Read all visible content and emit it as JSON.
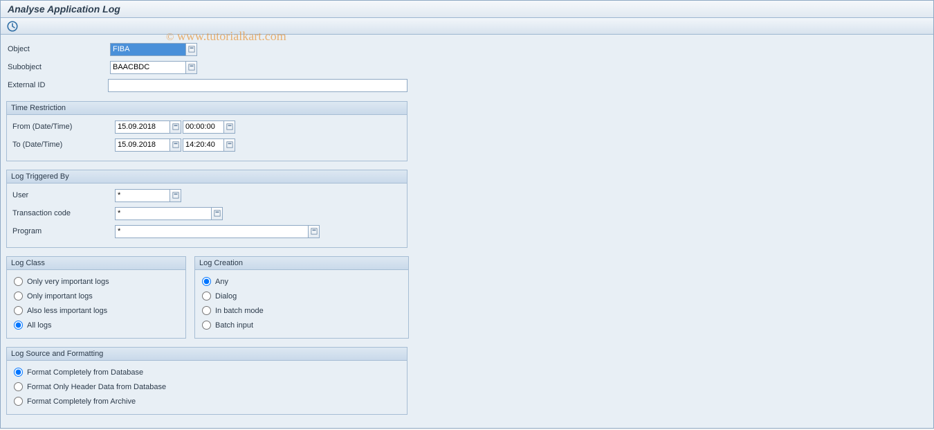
{
  "title": "Analyse Application Log",
  "watermark": "© www.tutorialkart.com",
  "fields": {
    "object_label": "Object",
    "object_value": "FIBA",
    "subobject_label": "Subobject",
    "subobject_value": "BAACBDC",
    "external_id_label": "External ID",
    "external_id_value": ""
  },
  "time_restriction": {
    "title": "Time Restriction",
    "from_label": "From (Date/Time)",
    "from_date": "15.09.2018",
    "from_time": "00:00:00",
    "to_label": "To (Date/Time)",
    "to_date": "15.09.2018",
    "to_time": "14:20:40"
  },
  "log_triggered": {
    "title": "Log Triggered By",
    "user_label": "User",
    "user_value": "*",
    "tcode_label": "Transaction code",
    "tcode_value": "*",
    "program_label": "Program",
    "program_value": "*"
  },
  "log_class": {
    "title": "Log Class",
    "options": [
      "Only very important logs",
      "Only important logs",
      "Also less important logs",
      "All logs"
    ],
    "selected": 3
  },
  "log_creation": {
    "title": "Log Creation",
    "options": [
      "Any",
      "Dialog",
      "In batch mode",
      "Batch input"
    ],
    "selected": 0
  },
  "log_source": {
    "title": "Log Source and Formatting",
    "options": [
      "Format Completely from Database",
      "Format Only Header Data from Database",
      "Format Completely from Archive"
    ],
    "selected": 0
  }
}
